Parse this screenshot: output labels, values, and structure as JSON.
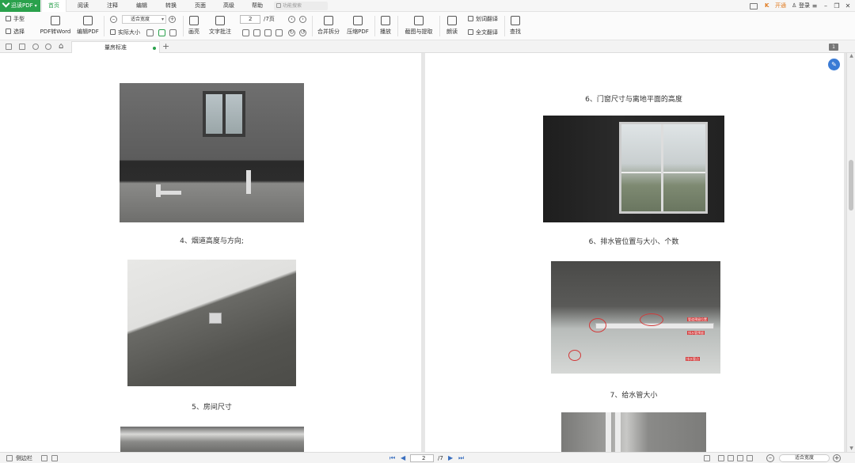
{
  "app": {
    "name": "迅读PDF",
    "menu": [
      "首页",
      "阅读",
      "注释",
      "编辑",
      "转换",
      "页面",
      "高级",
      "帮助"
    ],
    "active_menu": "首页",
    "search_placeholder": "功能搜索",
    "vip_label": "开通",
    "login_label": "登录"
  },
  "toolbar": {
    "hand": "手型",
    "select": "选择",
    "pdf_to_word": "PDF转Word",
    "edit_pdf": "编辑PDF",
    "zoom_value": "适合宽度",
    "actual_size": "实际大小",
    "highlight": "画亮",
    "text_note": "文字批注",
    "page_current": "2",
    "page_total": "/7页",
    "merge_split": "合并拆分",
    "compress_pdf": "压缩PDF",
    "play": "播放",
    "screenshot_ocr": "截图与提取",
    "read_aloud": "朗读",
    "translate_word": "划词翻译",
    "translate_full": "全文翻译",
    "find": "查找"
  },
  "tabs": {
    "doc_title": "量房标准",
    "page_badge": "1"
  },
  "document": {
    "left_captions": [
      "4、烟道高度与方向;",
      "5、房间尺寸"
    ],
    "right_captions": [
      "6、门窗尺寸与离地平面的高度",
      "6、排水管位置与大小、个数",
      "7、给水管大小"
    ],
    "drain_tags": [
      "管道预留位置",
      "排水管预留",
      "排水管点"
    ]
  },
  "statusbar": {
    "sidebar_label": "侧边栏",
    "page_current": "2",
    "page_total": "/7",
    "zoom_value": "适合宽度"
  },
  "colors": {
    "brand": "#2aa14c",
    "vip": "#e07a1f",
    "nav": "#3a6fbf",
    "float_icon": "#3a7bd5"
  }
}
